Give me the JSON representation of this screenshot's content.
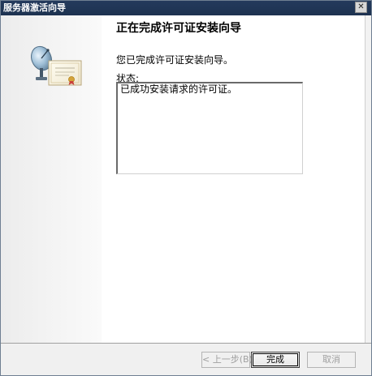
{
  "window": {
    "title": "服务器激活向导",
    "close_glyph": "✕"
  },
  "page": {
    "heading": "正在完成许可证安装向导",
    "description": "您已完成许可证安装向导。",
    "status_label": "状态:",
    "status_text": "已成功安装请求的许可证。"
  },
  "buttons": {
    "back": "< 上一步(B)",
    "finish": "完成",
    "cancel": "取消"
  }
}
